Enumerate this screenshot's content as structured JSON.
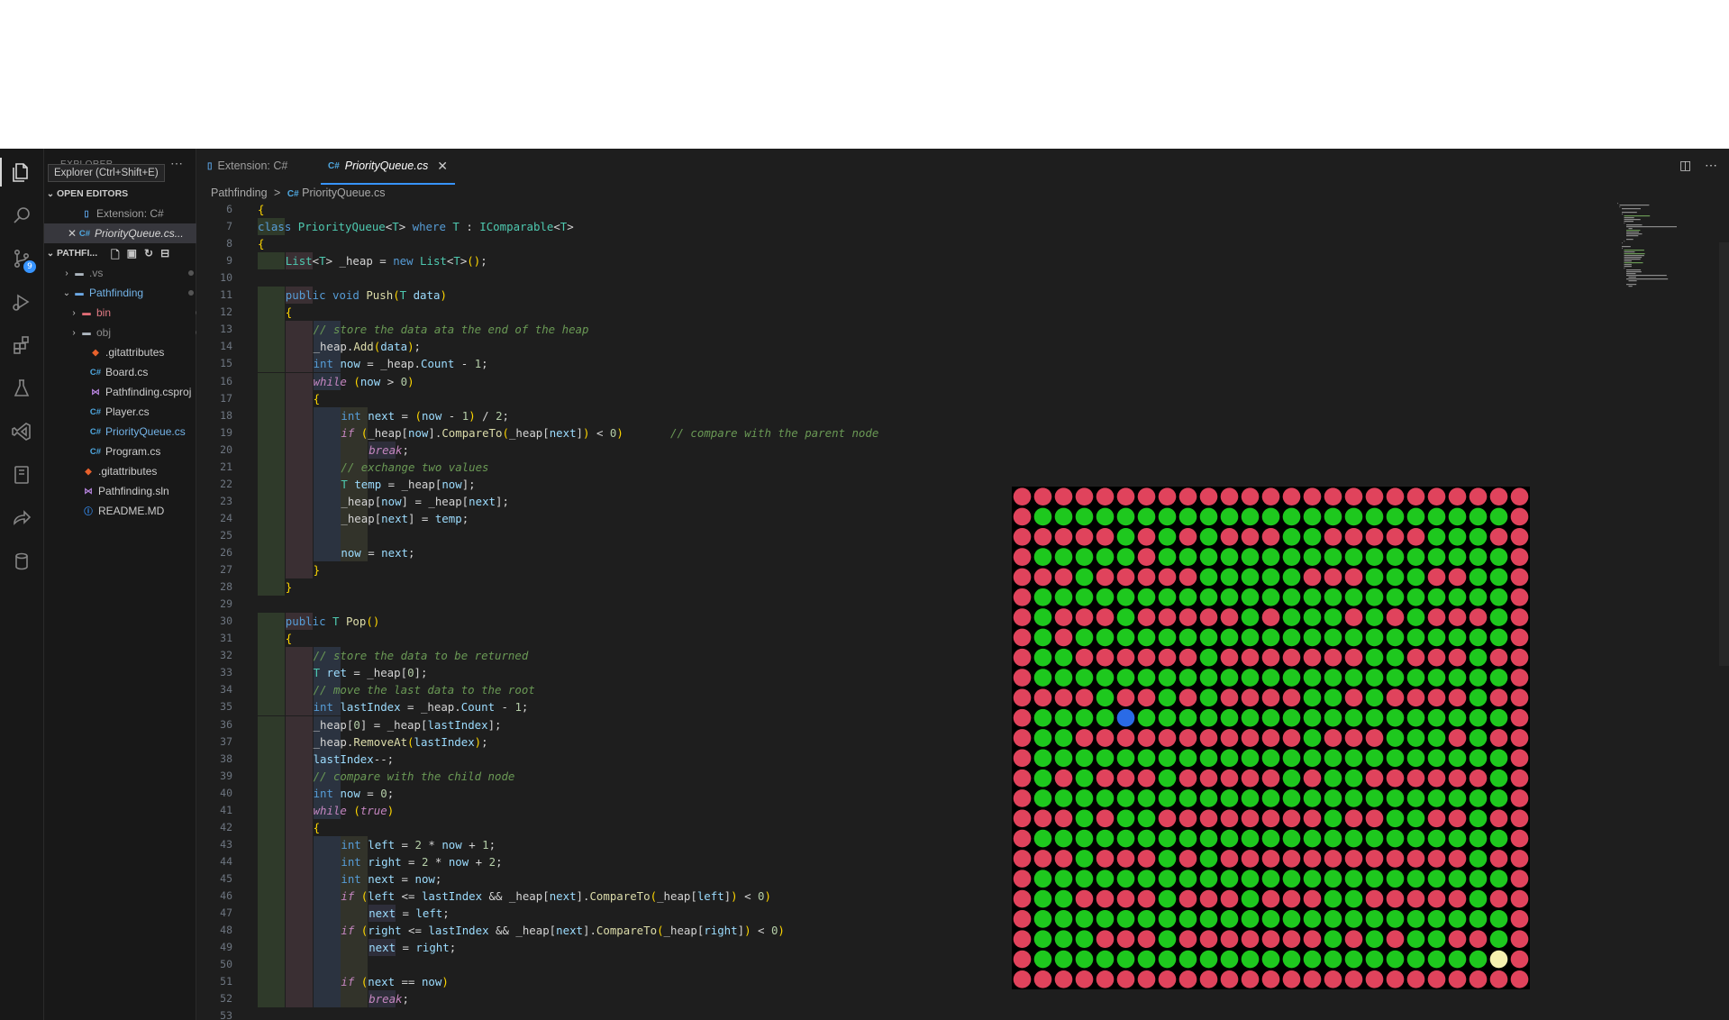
{
  "sidebar": {
    "title": "EXPLORER",
    "tooltip": "Explorer (Ctrl+Shift+E)",
    "open_editors_label": "OPEN EDITORS",
    "open_editors": [
      {
        "icon": "file",
        "label": "Extension: C#"
      },
      {
        "icon": "cs",
        "label": "PriorityQueue.cs..."
      }
    ],
    "project_label": "PATHFI...",
    "tree": [
      {
        "label": ".vs",
        "icon": "folder",
        "chevron": "right"
      },
      {
        "label": "Pathfinding",
        "icon": "folder-blue",
        "chevron": "down"
      },
      {
        "label": "bin",
        "icon": "folder-red",
        "chevron": "right"
      },
      {
        "label": "obj",
        "icon": "folder",
        "chevron": "right"
      },
      {
        "label": ".gitattributes",
        "icon": "git"
      },
      {
        "label": "Board.cs",
        "icon": "cs"
      },
      {
        "label": "Pathfinding.csproj",
        "icon": "vs"
      },
      {
        "label": "Player.cs",
        "icon": "cs"
      },
      {
        "label": "PriorityQueue.cs",
        "icon": "cs"
      },
      {
        "label": "Program.cs",
        "icon": "cs"
      },
      {
        "label": ".gitattributes",
        "icon": "git"
      },
      {
        "label": "Pathfinding.sln",
        "icon": "vs"
      },
      {
        "label": "README.MD",
        "icon": "info"
      }
    ]
  },
  "activity": {
    "scm_badge": "9"
  },
  "tabs": [
    {
      "label": "Extension: C#",
      "icon": "file",
      "active": false
    },
    {
      "label": "PriorityQueue.cs",
      "icon": "cs",
      "active": true
    }
  ],
  "breadcrumb": {
    "folder": "Pathfinding",
    "sep": ">",
    "cs_glyph": "C#",
    "file": "PriorityQueue.cs"
  },
  "icons": {
    "explorer": "files-icon",
    "search": "search-icon",
    "scm": "source-control-icon",
    "run": "run-debug-icon",
    "extensions": "extensions-icon",
    "testing": "beaker-icon",
    "vs": "visual-studio-icon",
    "remote": "remote-explorer-icon",
    "share": "live-share-icon",
    "db": "database-icon",
    "split": "split-editor-icon",
    "more": "ellipsis-icon"
  },
  "colors": {
    "wall": "#e0435c",
    "path": "#1ec81e",
    "player": "#2a6be6",
    "goal": "#f6f0b0",
    "accent": "#3794ff"
  },
  "code": {
    "lines": [
      {
        "n": "6",
        "d": 0,
        "t": "{"
      },
      {
        "n": "7",
        "d": 1,
        "t": "class PriorityQueue<T> where T : IComparable<T>"
      },
      {
        "n": "8",
        "d": 1,
        "t": "{"
      },
      {
        "n": "9",
        "d": 2,
        "t": "List<T> _heap = new List<T>();"
      },
      {
        "n": "10",
        "d": 0,
        "t": ""
      },
      {
        "n": "11",
        "d": 2,
        "t": "public void Push(T data)"
      },
      {
        "n": "12",
        "d": 2,
        "t": "{"
      },
      {
        "n": "13",
        "d": 3,
        "t": "// store the data ata the end of the heap"
      },
      {
        "n": "14",
        "d": 3,
        "t": "_heap.Add(data);"
      },
      {
        "n": "15",
        "d": 3,
        "t": "int now = _heap.Count - 1;"
      },
      {
        "n": "16",
        "d": 3,
        "t": "while (now > 0)"
      },
      {
        "n": "17",
        "d": 3,
        "t": "{"
      },
      {
        "n": "18",
        "d": 4,
        "t": "int next = (now - 1) / 2;"
      },
      {
        "n": "19",
        "d": 4,
        "t": "if (_heap[now].CompareTo(_heap[next]) < 0)       // compare with the parent node"
      },
      {
        "n": "20",
        "d": 5,
        "t": "break;"
      },
      {
        "n": "21",
        "d": 4,
        "t": "// exchange two values"
      },
      {
        "n": "22",
        "d": 4,
        "t": "T temp = _heap[now];"
      },
      {
        "n": "23",
        "d": 4,
        "t": "_heap[now] = _heap[next];"
      },
      {
        "n": "24",
        "d": 4,
        "t": "_heap[next] = temp;"
      },
      {
        "n": "25",
        "d": 4,
        "t": ""
      },
      {
        "n": "26",
        "d": 4,
        "t": "now = next;"
      },
      {
        "n": "27",
        "d": 3,
        "t": "}"
      },
      {
        "n": "28",
        "d": 2,
        "t": "}"
      },
      {
        "n": "29",
        "d": 0,
        "t": ""
      },
      {
        "n": "30",
        "d": 2,
        "t": "public T Pop()"
      },
      {
        "n": "31",
        "d": 2,
        "t": "{"
      },
      {
        "n": "32",
        "d": 3,
        "t": "// store the data to be returned"
      },
      {
        "n": "33",
        "d": 3,
        "t": "T ret = _heap[0];"
      },
      {
        "n": "34",
        "d": 3,
        "t": "// move the last data to the root"
      },
      {
        "n": "35",
        "d": 3,
        "t": "int lastIndex = _heap.Count - 1;"
      },
      {
        "n": "36",
        "d": 3,
        "t": "_heap[0] = _heap[lastIndex];"
      },
      {
        "n": "37",
        "d": 3,
        "t": "_heap.RemoveAt(lastIndex);"
      },
      {
        "n": "38",
        "d": 3,
        "t": "lastIndex--;"
      },
      {
        "n": "39",
        "d": 3,
        "t": "// compare with the child node"
      },
      {
        "n": "40",
        "d": 3,
        "t": "int now = 0;"
      },
      {
        "n": "41",
        "d": 3,
        "t": "while (true)"
      },
      {
        "n": "42",
        "d": 3,
        "t": "{"
      },
      {
        "n": "43",
        "d": 4,
        "t": "int left = 2 * now + 1;"
      },
      {
        "n": "44",
        "d": 4,
        "t": "int right = 2 * now + 2;"
      },
      {
        "n": "45",
        "d": 4,
        "t": "int next = now;"
      },
      {
        "n": "46",
        "d": 4,
        "t": "if (left <= lastIndex && _heap[next].CompareTo(_heap[left]) < 0)"
      },
      {
        "n": "47",
        "d": 5,
        "t": "next = left;"
      },
      {
        "n": "48",
        "d": 4,
        "t": "if (right <= lastIndex && _heap[next].CompareTo(_heap[right]) < 0)"
      },
      {
        "n": "49",
        "d": 5,
        "t": "next = right;"
      },
      {
        "n": "50",
        "d": 4,
        "t": ""
      },
      {
        "n": "51",
        "d": 4,
        "t": "if (next == now)"
      },
      {
        "n": "52",
        "d": 5,
        "t": "break;"
      },
      {
        "n": "53",
        "d": 0,
        "t": ""
      }
    ]
  },
  "maze": {
    "rows": [
      "WWWWWWWWWWWWWWWWWWWWWWWWW",
      "WPPPPPPPPPPPPPPPPPPPPPPPW",
      "WWWWWPWPWPWWWPPWWWWWPPPWW",
      "WPPPPPWPPPPPPPPPPPPPPPPPW",
      "WWWPWWWWWPPPPPWWWPPPWWPPW",
      "WPPPPPPPPPPPPPPPPPPPPPPPW",
      "WPWWWPWWWWWPWPPPWPWPWWWPW",
      "WPWPPPPPPPPPPPPPPPPPPPPPW",
      "WPPWWWWWWPWWWWWWWPPWWWPWW",
      "WPPPPPPPPPPPPPPPPPPPPPPPW",
      "WWWWPWWPWPWWWWPPWPWWWWPWW",
      "WPPPPPPPPPPPPPPPPPPPPPPPW",
      "WPPWWWWWWWWWWWPWWWPPPWPWW",
      "WPPPPPPPPPPPPPPPPPPPPPPPW",
      "WPWPWWWPWWWWWPWPPWWWWWWPW",
      "WPPPPPPPPPPPPPPPPPPPPPPPW",
      "WWWPWPPWWWWWWWWPWWPPWWPWW",
      "WPPPPPPPPPPPPPPPPPPPPPPPW",
      "WWWPWWWPWPWWWWWWWWWWWWPWW",
      "WPPPPPPPPPPPPPPPPPPPPPPPW",
      "WPPWWWWPWWWPWWWPPWWWWWPWW",
      "WPPPPPPPPPPPPPPPPPPPPPPPW",
      "WPPPWWWPWWWWWWWPWPWPPWWPW",
      "WPPPPPPPPPPPPPPPPPPPPPPGW",
      "WWWWWWWWWWWWWWWWWWWWWWWWW"
    ],
    "player": [
      11,
      5
    ],
    "goal": [
      23,
      23
    ]
  }
}
